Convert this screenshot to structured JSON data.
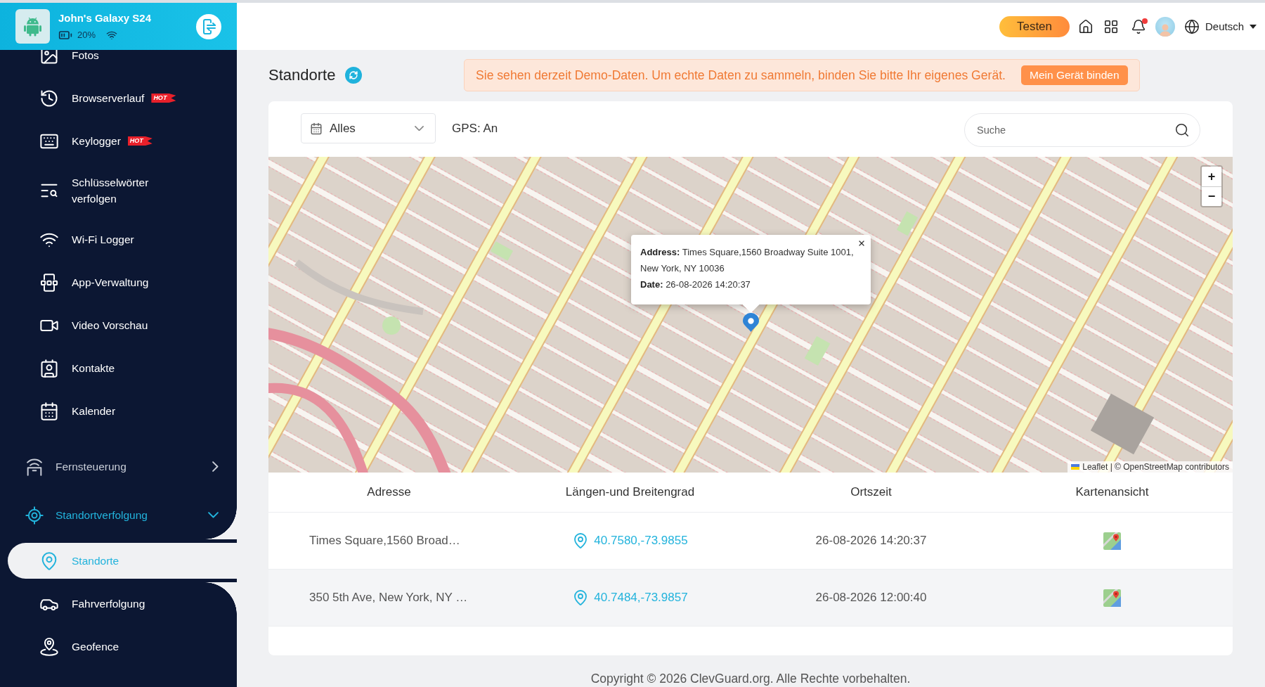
{
  "device": {
    "name": "John's Galaxy S24",
    "battery": "20%"
  },
  "sidebar": {
    "items": [
      {
        "kind": "item",
        "label": "Fotos",
        "selected": false
      },
      {
        "kind": "item",
        "label": "Browserverlauf",
        "badge": "HOT",
        "selected": false
      },
      {
        "kind": "item",
        "label": "Keylogger",
        "badge": "HOT",
        "selected": false
      },
      {
        "kind": "item",
        "label": "Schlüsselwörter verfolgen",
        "selected": false
      },
      {
        "kind": "item",
        "label": "Wi-Fi Logger",
        "selected": false
      },
      {
        "kind": "item",
        "label": "App-Verwaltung",
        "selected": false
      },
      {
        "kind": "item",
        "label": "Video Vorschau",
        "selected": false
      },
      {
        "kind": "item",
        "label": "Kontakte",
        "selected": false
      },
      {
        "kind": "item",
        "label": "Kalender",
        "selected": false
      },
      {
        "kind": "group",
        "label": "Fernsteuerung",
        "expanded": false,
        "selected": false
      },
      {
        "kind": "group",
        "label": "Standortverfolgung",
        "expanded": true,
        "selected": false,
        "children": [
          {
            "label": "Standorte",
            "selected": true
          },
          {
            "label": "Fahrverfolgung",
            "selected": false
          },
          {
            "label": "Geofence",
            "selected": false
          }
        ]
      }
    ]
  },
  "topbar": {
    "trial_button": "Testen",
    "unread_notifications": true,
    "language": "Deutsch"
  },
  "page": {
    "title": "Standorte"
  },
  "demo_banner": {
    "message": "Sie sehen derzeit Demo-Daten. Um echte Daten zu sammeln, binden Sie bitte Ihr eigenes Gerät.",
    "button": "Mein Gerät binden"
  },
  "filters": {
    "date_range": "Alles",
    "gps_status": "GPS: An",
    "search": {
      "placeholder": "Suche"
    }
  },
  "map": {
    "popup": {
      "lines": [
        "**Address:** Times Square,1560 Broadway Suite 1001, New York, NY 10036",
        "**Date:** 26-08-2026 14:20:37"
      ]
    },
    "zoom_controls": [
      "+",
      "−"
    ],
    "attribution": "Leaflet | © OpenStreetMap contributors"
  },
  "table": {
    "columns": [
      "Adresse",
      "Längen-und Breitengrad",
      "Ortszeit",
      "Kartenansicht"
    ],
    "rows": [
      {
        "address": "Times Square,1560 Broad…",
        "coordinates": "40.7580,-73.9855",
        "local_time": "26-08-2026 14:20:37"
      },
      {
        "address": "350 5th Ave, New York, NY …",
        "coordinates": "40.7484,-73.9857",
        "local_time": "26-08-2026 12:00:40"
      }
    ]
  },
  "footer": {
    "copyright": "Copyright © 2026 ClevGuard.org. Alle Rechte vorbehalten."
  }
}
